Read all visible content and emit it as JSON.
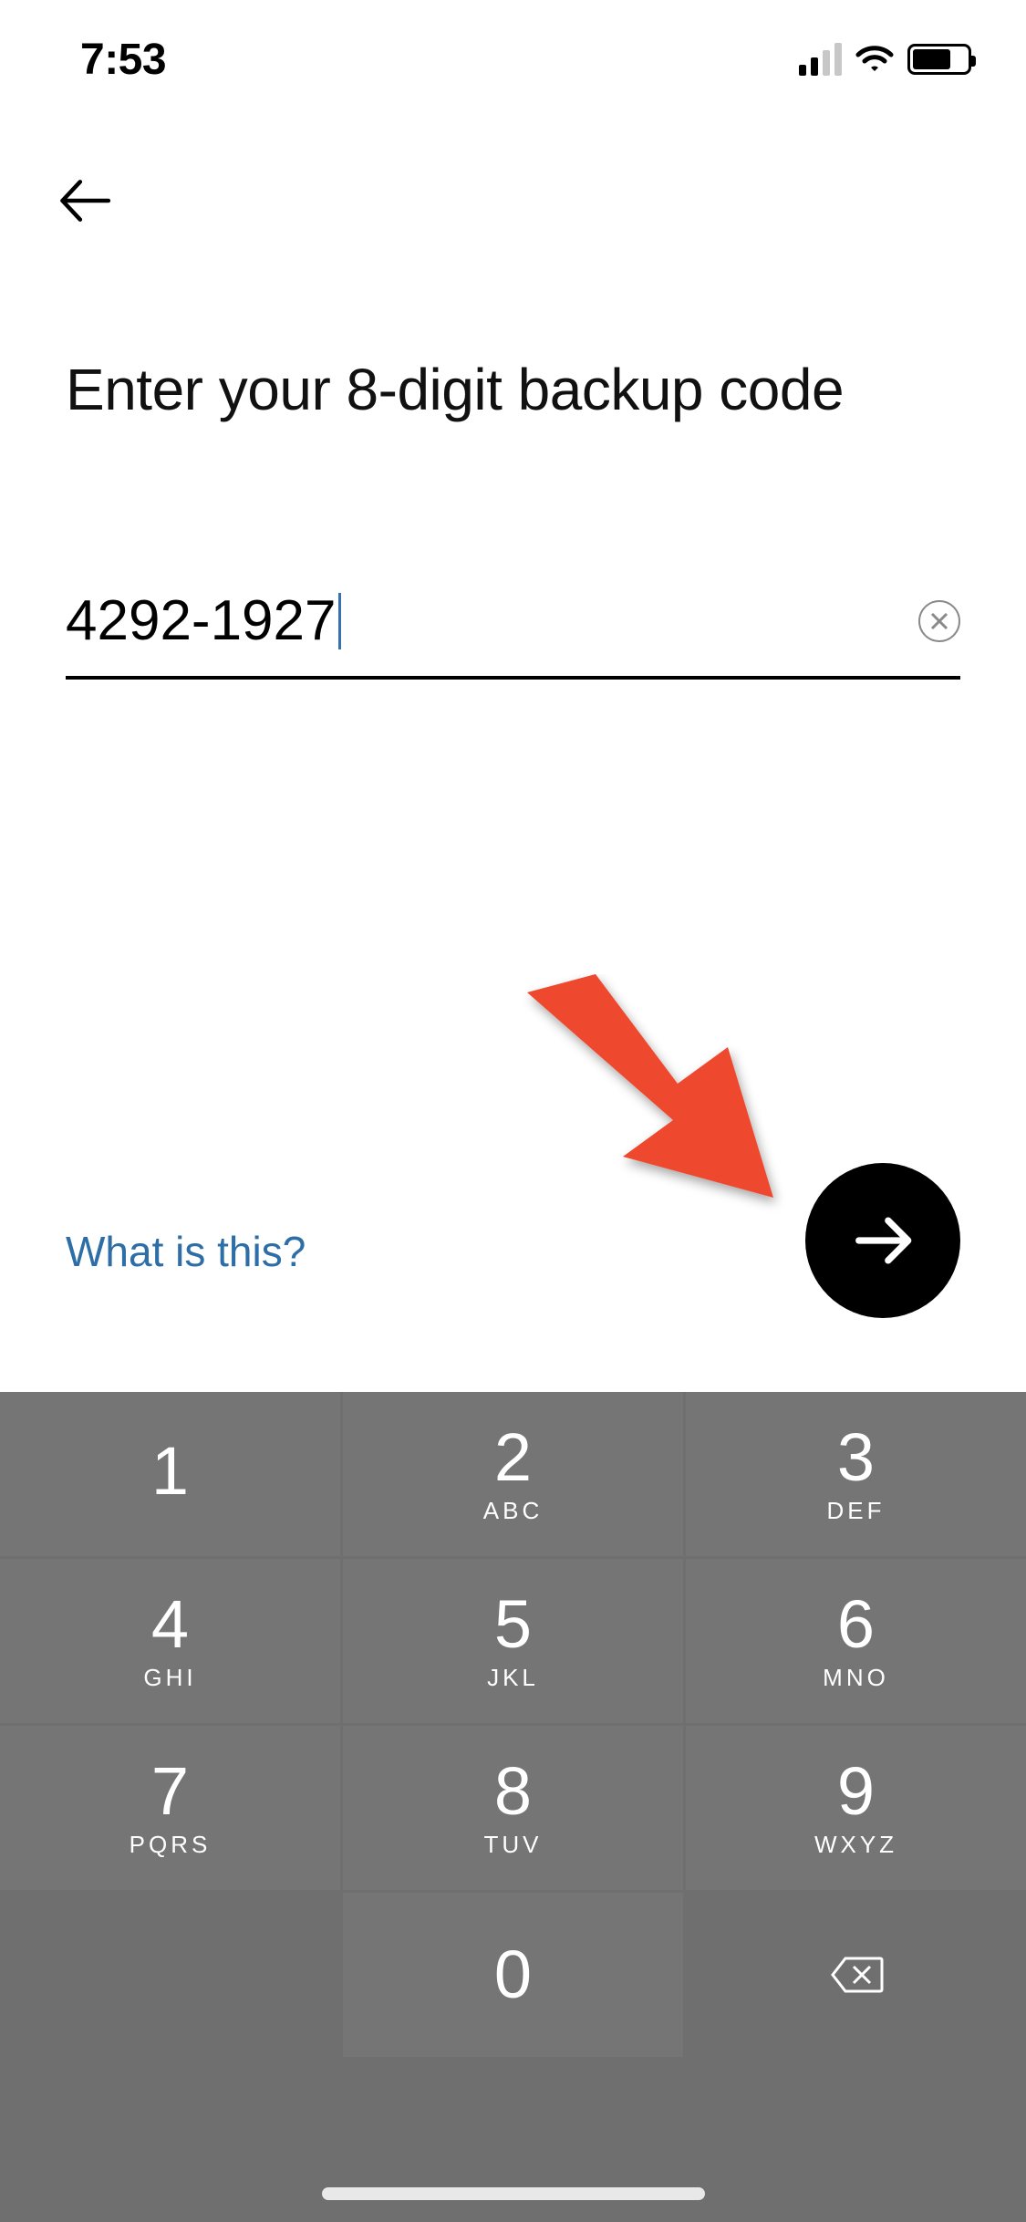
{
  "status": {
    "time": "7:53"
  },
  "nav": {
    "back": "Back"
  },
  "heading": "Enter your 8-digit backup code",
  "input": {
    "value": "4292-1927"
  },
  "help_link": "What is this?",
  "next_button": "Next",
  "keypad": {
    "keys": [
      {
        "num": "1",
        "letters": ""
      },
      {
        "num": "2",
        "letters": "ABC"
      },
      {
        "num": "3",
        "letters": "DEF"
      },
      {
        "num": "4",
        "letters": "GHI"
      },
      {
        "num": "5",
        "letters": "JKL"
      },
      {
        "num": "6",
        "letters": "MNO"
      },
      {
        "num": "7",
        "letters": "PQRS"
      },
      {
        "num": "8",
        "letters": "TUV"
      },
      {
        "num": "9",
        "letters": "WXYZ"
      },
      {
        "num": "0",
        "letters": ""
      }
    ]
  }
}
